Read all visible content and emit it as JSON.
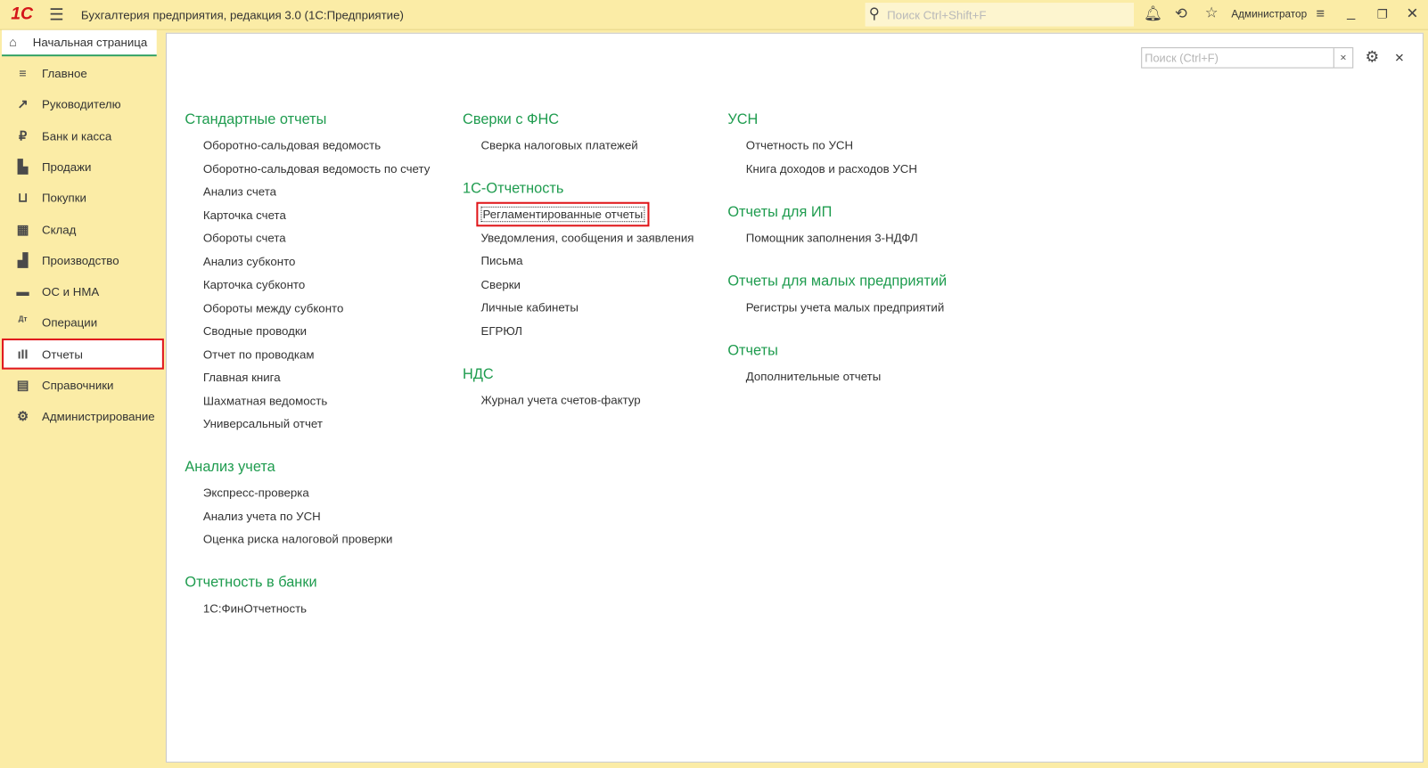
{
  "app": {
    "title": "Бухгалтерия предприятия, редакция 3.0  (1С:Предприятие)",
    "logo_text": "1С",
    "search_placeholder": "Поиск Ctrl+Shift+F",
    "user": "Администратор"
  },
  "tab": {
    "label": "Начальная страница"
  },
  "sidebar": {
    "items": [
      {
        "label": "Главное",
        "icon": "menu-icon",
        "glyph": "≡"
      },
      {
        "label": "Руководителю",
        "icon": "trend-icon",
        "glyph": "↗"
      },
      {
        "label": "Банк и касса",
        "icon": "ruble-icon",
        "glyph": "₽"
      },
      {
        "label": "Продажи",
        "icon": "shopping-bag-icon",
        "glyph": "▙"
      },
      {
        "label": "Покупки",
        "icon": "cart-icon",
        "glyph": "⊔"
      },
      {
        "label": "Склад",
        "icon": "warehouse-icon",
        "glyph": "▦"
      },
      {
        "label": "Производство",
        "icon": "factory-icon",
        "glyph": "▟"
      },
      {
        "label": "ОС и НМА",
        "icon": "truck-icon",
        "glyph": "▬"
      },
      {
        "label": "Операции",
        "icon": "debit-credit-icon",
        "glyph": "Дт"
      },
      {
        "label": "Отчеты",
        "icon": "bar-chart-icon",
        "glyph": "ıII",
        "active": true
      },
      {
        "label": "Справочники",
        "icon": "books-icon",
        "glyph": "▤"
      },
      {
        "label": "Администрирование",
        "icon": "gear-icon",
        "glyph": "⚙"
      }
    ]
  },
  "content": {
    "search_placeholder": "Поиск (Ctrl+F)",
    "columns": [
      [
        {
          "heading": "Стандартные отчеты",
          "items": [
            "Оборотно-сальдовая ведомость",
            "Оборотно-сальдовая ведомость по счету",
            "Анализ счета",
            "Карточка счета",
            "Обороты счета",
            "Анализ субконто",
            "Карточка субконто",
            "Обороты между субконто",
            "Сводные проводки",
            "Отчет по проводкам",
            "Главная книга",
            "Шахматная ведомость",
            "Универсальный отчет"
          ]
        },
        {
          "heading": "Анализ учета",
          "items": [
            "Экспресс-проверка",
            "Анализ учета по УСН",
            "Оценка риска налоговой проверки"
          ]
        },
        {
          "heading": "Отчетность в банки",
          "items": [
            "1С:ФинОтчетность"
          ]
        }
      ],
      [
        {
          "heading": "Сверки с ФНС",
          "items": [
            "Сверка налоговых платежей"
          ]
        },
        {
          "heading": "1С-Отчетность",
          "items": [
            "Регламентированные отчеты",
            "Уведомления, сообщения и заявления",
            "Письма",
            "Сверки",
            "Личные кабинеты",
            "ЕГРЮЛ"
          ],
          "highlight": 0
        },
        {
          "heading": "НДС",
          "items": [
            "Журнал учета счетов-фактур"
          ]
        }
      ],
      [
        {
          "heading": "УСН",
          "items": [
            "Отчетность по УСН",
            "Книга доходов и расходов УСН"
          ]
        },
        {
          "heading": "Отчеты для ИП",
          "items": [
            "Помощник заполнения 3-НДФЛ"
          ]
        },
        {
          "heading": "Отчеты для малых предприятий",
          "items": [
            "Регистры учета малых предприятий"
          ]
        },
        {
          "heading": "Отчеты",
          "items": [
            "Дополнительные отчеты"
          ]
        }
      ]
    ]
  },
  "colors": {
    "accent_green": "#1f9c4f",
    "highlight_red": "#e0161a",
    "sidebar_bg": "#fbeca6"
  }
}
